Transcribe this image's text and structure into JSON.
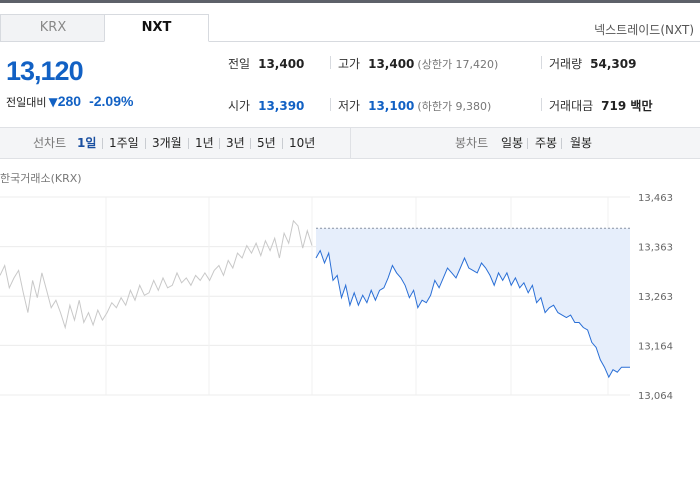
{
  "tabs": [
    {
      "label": "KRX",
      "active": false
    },
    {
      "label": "NXT",
      "active": true
    }
  ],
  "market_link": "넥스트레이드(NXT)",
  "price": {
    "current": "13,120",
    "change_label": "전일대비",
    "change_arrow": "▼",
    "change": "280",
    "change_pct": "-2.09%",
    "color": "#1261c4"
  },
  "stats": {
    "prev_close": {
      "label": "전일",
      "value": "13,400"
    },
    "high": {
      "label": "고가",
      "value": "13,400",
      "sub": "(상한가 17,420)"
    },
    "volume": {
      "label": "거래량",
      "value": "54,309"
    },
    "open": {
      "label": "시가",
      "value": "13,390"
    },
    "low": {
      "label": "저가",
      "value": "13,100",
      "sub": "(하한가 9,380)"
    },
    "turnover": {
      "label": "거래대금",
      "value": "719 백만"
    }
  },
  "periods": {
    "label": "선차트",
    "items": [
      "1일",
      "1주일",
      "3개월",
      "1년",
      "3년",
      "5년",
      "10년"
    ],
    "active": "1일"
  },
  "candles": {
    "label": "봉차트",
    "items": [
      "일봉",
      "주봉",
      "월봉"
    ]
  },
  "chart_title": "한국거래소(KRX)",
  "chart_data": {
    "type": "line",
    "ylim": [
      13064,
      13463
    ],
    "ytick_labels": [
      "13,463",
      "13,363",
      "13,263",
      "13,164",
      "13,064"
    ],
    "yticks": [
      13463,
      13363,
      13263,
      13164,
      13064
    ],
    "reference_price": 13400,
    "krx_color": "#c8c8c8",
    "nxt_color": "#2a6fd6",
    "fill_color": "#e6eefb",
    "series": [
      {
        "key": "krx",
        "values": [
          13305,
          13325,
          13280,
          13300,
          13315,
          13270,
          13230,
          13295,
          13260,
          13310,
          13275,
          13240,
          13255,
          13230,
          13200,
          13245,
          13215,
          13255,
          13210,
          13230,
          13205,
          13235,
          13215,
          13230,
          13250,
          13240,
          13260,
          13245,
          13275,
          13255,
          13285,
          13265,
          13270,
          13295,
          13275,
          13300,
          13280,
          13285,
          13310,
          13290,
          13300,
          13285,
          13305,
          13295,
          13310,
          13295,
          13315,
          13325,
          13305,
          13335,
          13320,
          13350,
          13340,
          13365,
          13350,
          13370,
          13345,
          13375,
          13355,
          13380,
          13340,
          13390,
          13370,
          13415,
          13405,
          13360,
          13395,
          13365
        ]
      },
      {
        "key": "nxt",
        "values": [
          13340,
          13355,
          13330,
          13350,
          13295,
          13305,
          13260,
          13285,
          13245,
          13270,
          13245,
          13265,
          13250,
          13275,
          13255,
          13275,
          13280,
          13300,
          13325,
          13310,
          13300,
          13285,
          13260,
          13275,
          13240,
          13255,
          13250,
          13265,
          13295,
          13280,
          13300,
          13320,
          13310,
          13300,
          13320,
          13340,
          13320,
          13315,
          13310,
          13330,
          13320,
          13305,
          13285,
          13310,
          13295,
          13310,
          13285,
          13300,
          13280,
          13290,
          13270,
          13285,
          13250,
          13260,
          13230,
          13240,
          13245,
          13230,
          13225,
          13220,
          13225,
          13210,
          13210,
          13200,
          13195,
          13170,
          13160,
          13135,
          13120,
          13100,
          13115,
          13110,
          13120,
          13120,
          13120
        ]
      }
    ]
  }
}
